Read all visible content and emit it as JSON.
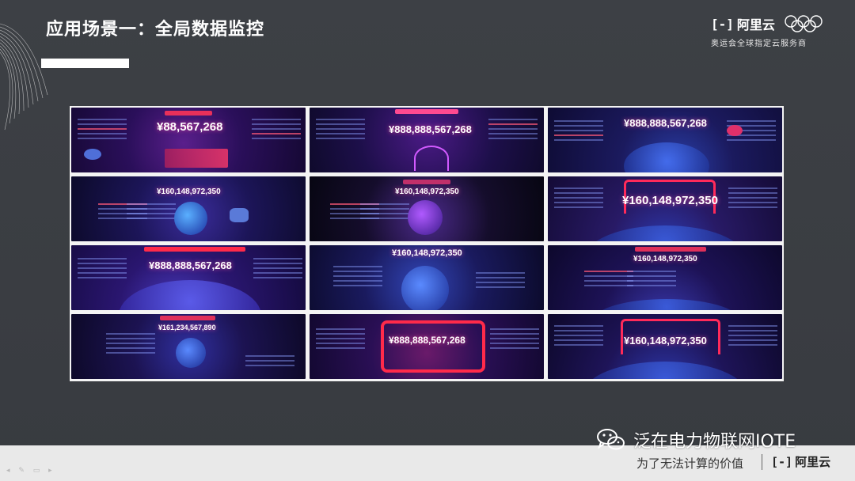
{
  "slide": {
    "title": "应用场景一：全局数据监控"
  },
  "brand": {
    "logo_bracket": "[-]",
    "logo_name": "阿里云",
    "subtitle": "奥运会全球指定云服务商"
  },
  "tiles": [
    {
      "number": "¥88,567,268"
    },
    {
      "number": "¥888,888,567,268"
    },
    {
      "number": "¥888,888,567,268"
    },
    {
      "number": "¥160,148,972,350"
    },
    {
      "number": "¥160,148,972,350"
    },
    {
      "number": "¥160,148,972,350"
    },
    {
      "number": "¥888,888,567,268"
    },
    {
      "number": "¥160,148,972,350"
    },
    {
      "number": "¥160,148,972,350"
    },
    {
      "number": "¥161,234,567,890"
    },
    {
      "number": "¥888,888,567,268"
    },
    {
      "number": "¥160,148,972,350"
    }
  ],
  "footer": {
    "watermark": "泛在电力物联网IOTE",
    "slogan": "为了无法计算的价值",
    "logo_bracket": "[-]",
    "logo_name": "阿里云"
  }
}
